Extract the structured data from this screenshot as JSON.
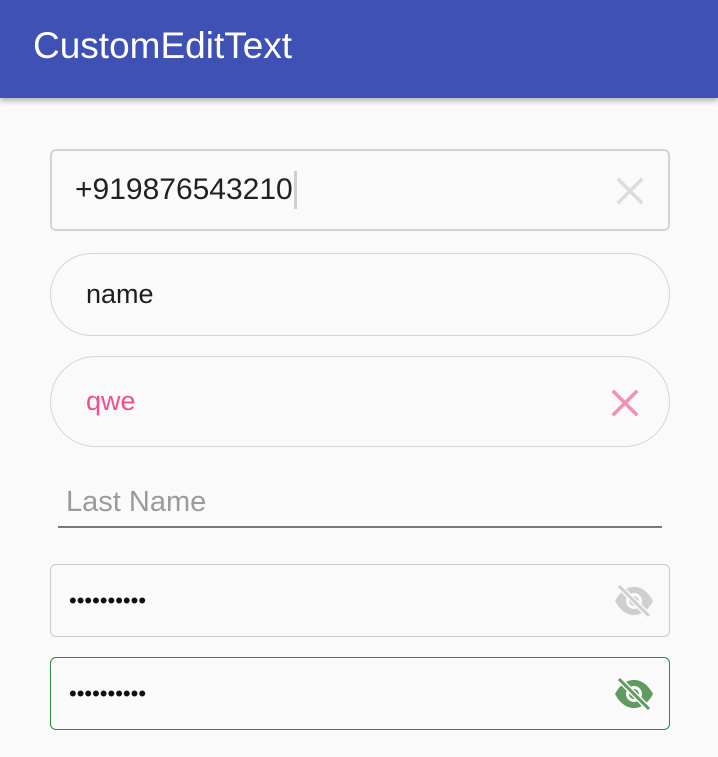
{
  "app_bar": {
    "title": "CustomEditText",
    "color": "#3f51b5"
  },
  "fields": {
    "phone": {
      "value": "+919876543210",
      "trailing_icon": "close-icon",
      "icon_color": "#dcdcdc"
    },
    "name": {
      "value": "name"
    },
    "qwe": {
      "value": "qwe",
      "text_color": "#f0508c",
      "trailing_icon": "close-icon",
      "icon_color": "#f48fb1"
    },
    "last_name": {
      "placeholder": "Last Name",
      "value": ""
    },
    "password_1": {
      "value": "••••••••••",
      "trailing_icon": "eye-off-icon",
      "icon_color": "#cfcfcf"
    },
    "password_2": {
      "value": "••••••••••",
      "trailing_icon": "eye-off-icon",
      "icon_color": "#5f9a5f",
      "border_color": "#2e8b3a"
    }
  }
}
